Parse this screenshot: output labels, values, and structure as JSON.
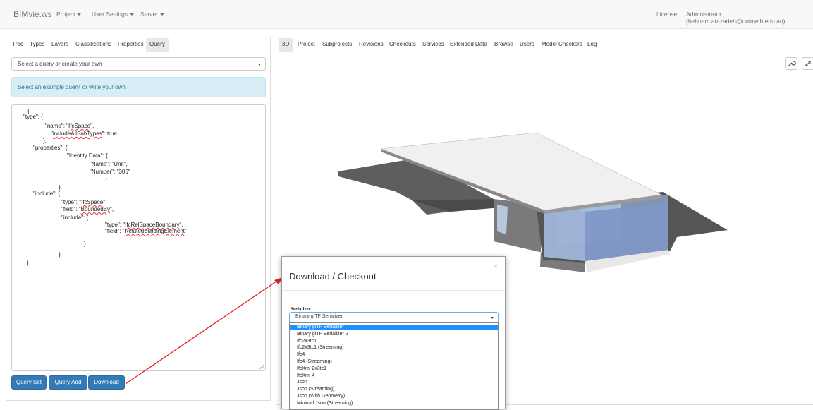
{
  "navbar": {
    "brand": "BIMvie.ws",
    "menus": [
      "Project",
      "User Settings",
      "Server"
    ],
    "license": "License",
    "user": "Administrator (behnam.atazadeh@unimelb.edu.au)"
  },
  "left_panel": {
    "tabs": [
      "Tree",
      "Types",
      "Layers",
      "Classifications",
      "Properties",
      "Query"
    ],
    "active_tab": "Query",
    "query_select": "Select a query or create your own",
    "info": "Select an example query, or write your own",
    "code_lines": [
      [
        "{"
      ],
      [
        "\"type\": {"
      ],
      [
        "\"name\": \"",
        "IfcSpace",
        "\","
      ],
      [
        "\"",
        "includeAllSubTypes",
        "\": true"
      ],
      [
        "},"
      ],
      [
        "\"properties\": {"
      ],
      [
        "\"Identity Data\": {"
      ],
      [
        "\"Name\": \"Unit\","
      ],
      [
        "\"Number\": \"306\""
      ],
      [
        "}"
      ],
      [
        "},"
      ],
      [
        "\"include\": {"
      ],
      [
        "\"type\": \"",
        "IfcSpace",
        "\","
      ],
      [
        "\"field\": \"",
        "BoundedBy",
        "\","
      ],
      [
        "\"include\": {"
      ],
      [
        "\"type\": \"",
        "IfcRelSpaceBoundary",
        "\","
      ],
      [
        "\"field\": \"",
        "RelatedBuildingElement",
        "\""
      ],
      [
        "}"
      ],
      [
        "}"
      ],
      [
        "}"
      ]
    ],
    "buttons": {
      "query_set": "Query Set",
      "query_add": "Query Add",
      "download": "Download"
    }
  },
  "right_panel": {
    "tabs": [
      "3D",
      "Project",
      "Subprojects",
      "Revisions",
      "Checkouts",
      "Services",
      "Extended Data",
      "Browse",
      "Users",
      "Model Checkers",
      "Log"
    ],
    "active_tab": "3D",
    "toolbar_icons": [
      "wrench-icon",
      "fullscreen-icon"
    ]
  },
  "modal": {
    "title": "Download / Checkout",
    "close": "×",
    "serializer_label": "Serializer",
    "selected": "Binary glTF Serializer",
    "options": [
      "Binary glTF Serializer",
      "Binary glTF Serializer 2",
      "Ifc2x3tc1",
      "Ifc2x3tc1 (Streaming)",
      "Ifc4",
      "Ifc4 (Streaming)",
      "IfcXml 2x3tc1",
      "IfcXml 4",
      "Json",
      "Json (Streaming)",
      "Json (With Geometry)",
      "Minimal Json (Streaming)"
    ],
    "highlighted_index": 0
  },
  "colors": {
    "primary": "#337ab7",
    "info_bg": "#d9edf7",
    "highlight": "#1e90ff",
    "arrow": "#e02020",
    "glass": "#9fb3d6"
  }
}
